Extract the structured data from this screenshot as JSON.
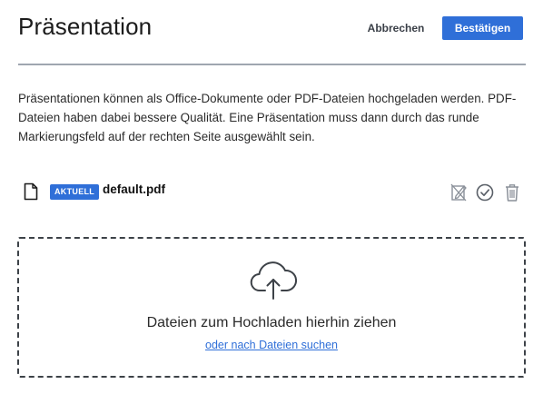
{
  "header": {
    "title": "Präsentation",
    "cancel_label": "Abbrechen",
    "confirm_label": "Bestätigen"
  },
  "description": "Präsentationen können als Office-Dokumente oder PDF-Dateien hochgeladen werden. PDF-Dateien haben dabei bessere Qualität. Eine Präsentation muss dann durch das runde Markierungsfeld auf der rechten Seite ausgewählt sein.",
  "files": [
    {
      "icon": "file-icon",
      "badge": "AKTUELL",
      "name": "default.pdf",
      "actions": [
        "edit-disabled-icon",
        "check-circle-icon",
        "trash-icon"
      ]
    }
  ],
  "dropzone": {
    "icon": "cloud-upload-icon",
    "text": "Dateien zum Hochladen hierhin ziehen",
    "link_text": "oder nach Dateien suchen"
  },
  "colors": {
    "accent": "#2f6fd8",
    "divider": "#9fa6b0",
    "icon_gray": "#8a9099",
    "text": "#212529"
  }
}
